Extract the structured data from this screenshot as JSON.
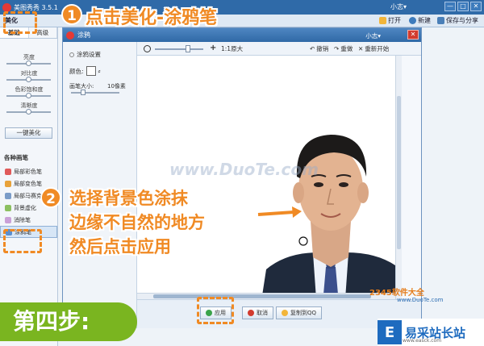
{
  "app": {
    "title": "美图秀秀 3.5.1",
    "user": "小志▾",
    "window_controls": [
      "—",
      "□",
      "✕"
    ]
  },
  "main_toolbar": {
    "open_label": "打开",
    "new_label": "新建",
    "save_share_label": "保存与分享",
    "beautify_tab": "美化"
  },
  "left_panel": {
    "tabs": [
      "基础",
      "高级"
    ],
    "sliders": [
      "亮度",
      "对比度",
      "色彩饱和度",
      "清晰度"
    ],
    "one_key_label": "一键美化",
    "brush_header": "各种画笔",
    "brushes": [
      "局部彩色笔",
      "局部变色笔",
      "局部马赛克",
      "背景虚化",
      "消除笔",
      "涂鸦笔"
    ]
  },
  "dialog": {
    "title": "涂鸦",
    "user": "小志▾",
    "settings_header": "涂鸦设置",
    "color_label": "颜色:",
    "brush_size_label": "画笔大小:",
    "brush_size_value": "10像素",
    "toolbar": {
      "actual_size_label": "1:1原大",
      "undo_label": "撤销",
      "redo_label": "重做",
      "restart_label": "重新开始"
    },
    "footer": {
      "apply_label": "应用",
      "cancel_label": "取消",
      "copy_label": "复制到QQ"
    }
  },
  "annotations": {
    "step1_number": "1",
    "step1_text": "点击美化-涂鸦笔",
    "step2_number": "2",
    "step2_lines": [
      "选择背景色涂抹",
      "边缘不自然的地方",
      "然后点击应用"
    ],
    "step_banner": "第四步:",
    "watermark": "www.DuoTe.com",
    "site_logo": "2345软件大全",
    "site_url": "www.DuoTe.com",
    "brand_name": "易采站长站",
    "brand_url": "www.easck.com"
  },
  "colors": {
    "accent_orange": "#f08a24",
    "banner_green": "#7ab520",
    "titlebar_blue": "#2f6aa8",
    "brand_blue": "#1e6bbf"
  }
}
